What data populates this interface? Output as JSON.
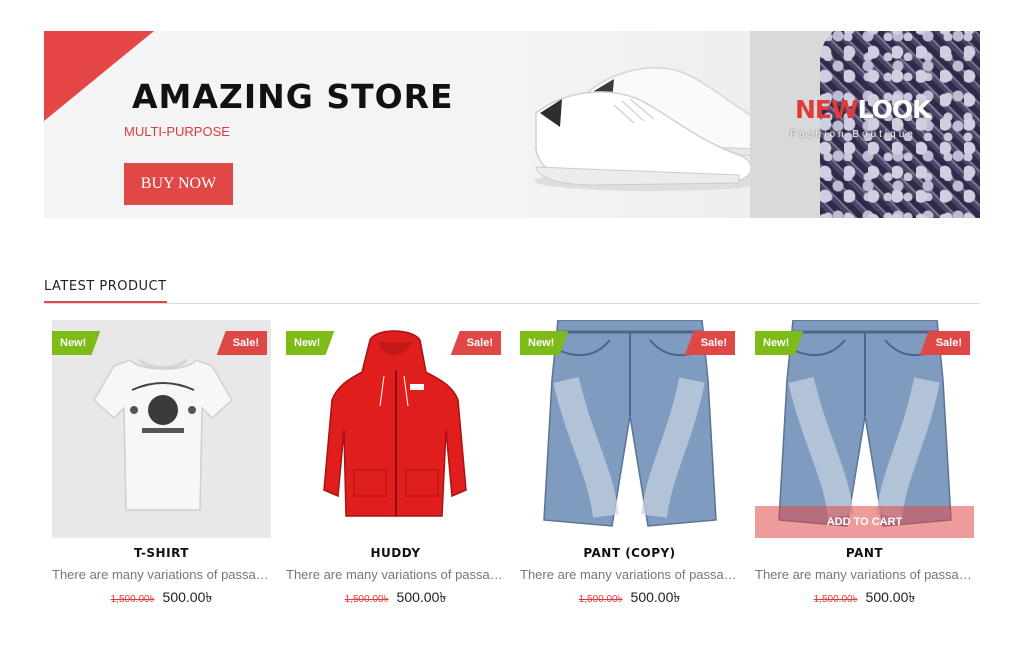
{
  "banner": {
    "title": "AMAZING STORE",
    "subtitle": "MULTI-PURPOSE",
    "cta_label": "BUY NOW",
    "brand_new": "NEW",
    "brand_look": "LOOK",
    "brand_tagline": "Fashion Boutique",
    "accent_color": "#e04848"
  },
  "section": {
    "title": "LATEST  PRODUCT"
  },
  "badges": {
    "new": "New!",
    "sale": "Sale!"
  },
  "products": [
    {
      "name": "T-SHIRT",
      "description": "There are many variations of passage...",
      "old_price": "1,500.00৳",
      "price": "500.00৳",
      "image": "tshirt"
    },
    {
      "name": "HUDDY",
      "description": "There are many variations of passage...",
      "old_price": "1,500.00৳",
      "price": "500.00৳",
      "image": "hoodie"
    },
    {
      "name": "PANT (COPY)",
      "description": "There are many variations of passage...",
      "old_price": "1,500.00৳",
      "price": "500.00৳",
      "image": "jeans-shorts"
    },
    {
      "name": "PANT",
      "description": "There are many variations of passage...",
      "old_price": "1,500.00৳",
      "price": "500.00৳",
      "image": "jeans-shorts",
      "hover_action": "ADD TO CART"
    }
  ],
  "colors": {
    "new_badge": "#7dbb16",
    "sale_badge": "#e04848",
    "old_price": "#e03a3a"
  }
}
